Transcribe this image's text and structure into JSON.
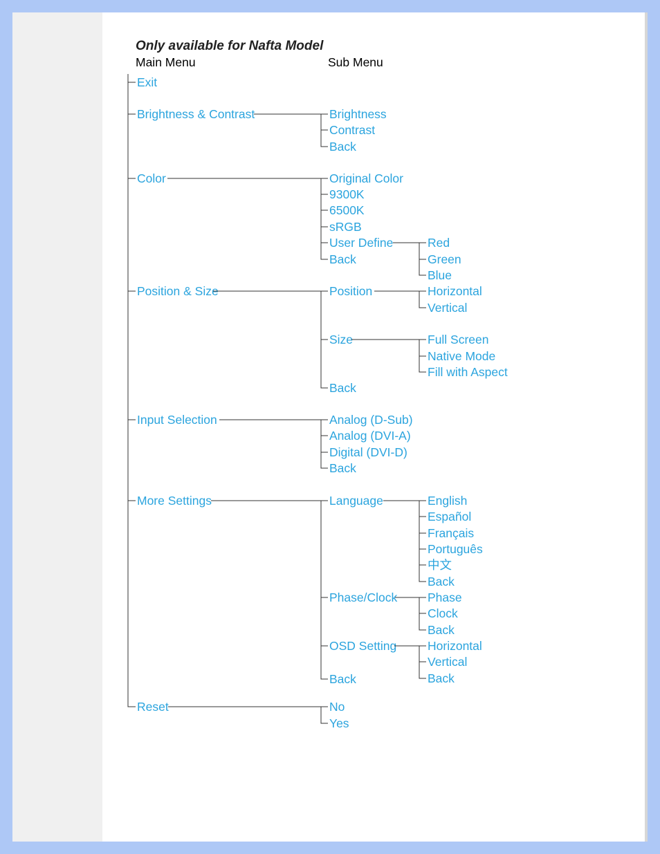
{
  "title": "Only available for Nafta Model",
  "columns": {
    "main": "Main Menu",
    "sub": "Sub Menu"
  },
  "menu": {
    "exit": "Exit",
    "brightness_contrast": {
      "label": "Brightness & Contrast",
      "items": [
        "Brightness",
        "Contrast",
        "Back"
      ]
    },
    "color": {
      "label": "Color",
      "items": [
        "Original Color",
        "9300K",
        "6500K",
        "sRGB",
        "User Define",
        "Back"
      ],
      "user_define": [
        "Red",
        "Green",
        "Blue"
      ]
    },
    "position_size": {
      "label": "Position & Size",
      "position": {
        "label": "Position",
        "items": [
          "Horizontal",
          "Vertical"
        ]
      },
      "size": {
        "label": "Size",
        "items": [
          "Full Screen",
          "Native Mode",
          "Fill with Aspect"
        ]
      },
      "back": "Back"
    },
    "input_selection": {
      "label": "Input Selection",
      "items": [
        "Analog (D-Sub)",
        "Analog (DVI-A)",
        "Digital (DVI-D)",
        "Back"
      ]
    },
    "more_settings": {
      "label": "More Settings",
      "language": {
        "label": "Language",
        "items": [
          "English",
          "Español",
          "Français",
          "Português",
          "中文",
          "Back"
        ]
      },
      "phase_clock": {
        "label": "Phase/Clock",
        "items": [
          "Phase",
          "Clock",
          "Back"
        ]
      },
      "osd_setting": {
        "label": "OSD Setting",
        "items": [
          "Horizontal",
          "Vertical",
          "Back"
        ]
      },
      "back": "Back"
    },
    "reset": {
      "label": "Reset",
      "items": [
        "No",
        "Yes"
      ]
    }
  }
}
